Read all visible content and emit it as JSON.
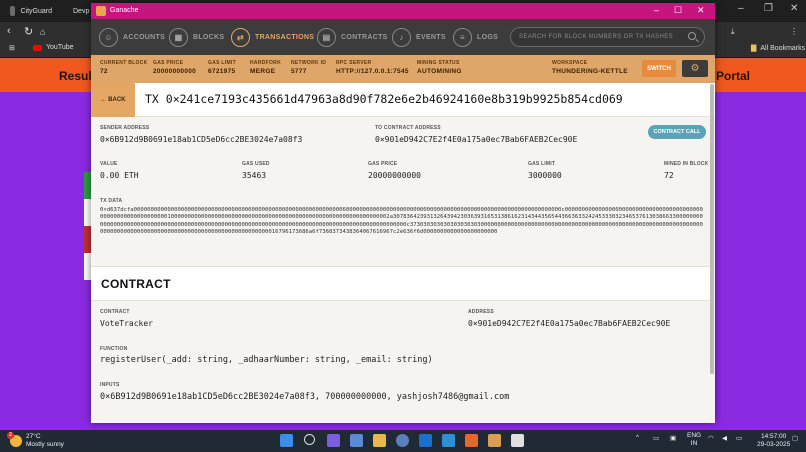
{
  "browser": {
    "tabs": [
      {
        "label": "CityGuard"
      },
      {
        "label": "Devp"
      }
    ],
    "bookmarks": [
      {
        "label": "YouTube"
      },
      {
        "label": "All Bookmarks"
      }
    ],
    "page_text_left": "Result",
    "page_text_right": "Portal"
  },
  "window": {
    "title": "Ganache"
  },
  "nav": {
    "items": [
      {
        "label": "ACCOUNTS",
        "icon": "accounts-icon",
        "active": false
      },
      {
        "label": "BLOCKS",
        "icon": "blocks-icon",
        "active": false
      },
      {
        "label": "TRANSACTIONS",
        "icon": "transactions-icon",
        "active": true
      },
      {
        "label": "CONTRACTS",
        "icon": "contracts-icon",
        "active": false
      },
      {
        "label": "EVENTS",
        "icon": "events-icon",
        "active": false
      },
      {
        "label": "LOGS",
        "icon": "logs-icon",
        "active": false
      }
    ],
    "search_placeholder": "SEARCH FOR BLOCK NUMBERS OR TX HASHES"
  },
  "status": {
    "current_block_label": "CURRENT BLOCK",
    "current_block": "72",
    "gas_price_label": "GAS PRICE",
    "gas_price": "20000000000",
    "gas_limit_label": "GAS LIMIT",
    "gas_limit": "6721975",
    "hardfork_label": "HARDFORK",
    "hardfork": "MERGE",
    "network_id_label": "NETWORK ID",
    "network_id": "5777",
    "rpc_server_label": "RPC SERVER",
    "rpc_server": "HTTP://127.0.0.1:7545",
    "mining_status_label": "MINING STATUS",
    "mining_status": "AUTOMINING",
    "workspace_label": "WORKSPACE",
    "workspace": "THUNDERING-KETTLE",
    "switch_label": "SWITCH"
  },
  "tx": {
    "back_label": "← BACK",
    "hash": "TX 0×241ce7193c435661d47963a8d90f782e6e2b46924160e8b319b9925b854cd069",
    "sender_label": "SENDER ADDRESS",
    "sender": "0×6B912d9B0691e18ab1CD5eD6cc2BE3024e7a08f3",
    "to_label": "TO CONTRACT ADDRESS",
    "to": "0×901eD942C7E2f4E0a175a0ec7Bab6FAEB2Cec90E",
    "call_label": "CONTRACT CALL",
    "value_label": "VALUE",
    "value": "0.00 ETH",
    "gas_used_label": "GAS USED",
    "gas_used": "35463",
    "gas_price_label": "GAS PRICE",
    "gas_price": "20000000000",
    "gas_limit_label": "GAS LIMIT",
    "gas_limit": "3000000",
    "mined_label": "MINED IN BLOCK",
    "mined": "72",
    "data_label": "TX DATA",
    "data": "0×d637dcfa0000000000000000000000000000000000000000000000000000000000000060000000000000000000000000000000000000000000000000000000000000000c0000000000000000000000000000000000000000000000000000000000000100000000000000000000000000000000000000000000000000000000000000002a307836423931326439423036393165313861623143443565443663633242453330323465376130386633000000000000000000000000000000000000000000000000000000000000000000000000000000000000000000000000000c37303030303030303030300000000000000000000000000000000000000000000000000000000000000000000000000000000000000000000000000000000000000000000016796173686a6f7368373438364067616967c2e636f6d0000000000000000000000"
  },
  "contract": {
    "heading": "CONTRACT",
    "contract_label": "CONTRACT",
    "contract_name": "VoteTracker",
    "address_label": "ADDRESS",
    "address": "0×901eD942C7E2f4E0a175a0ec7Bab6FAEB2Cec90E",
    "function_label": "FUNCTION",
    "function": "registerUser(_add: string, _adhaarNumber: string, _email: string)",
    "inputs_label": "INPUTS",
    "inputs": "0×6B912d9B0691e18ab1CD5eD6cc2BE3024e7a08f3, 700000000000, yashjosh7486@gmail.com"
  },
  "taskbar": {
    "temp": "27°C",
    "weather": "Mostly sunny",
    "weather_badge": "2",
    "lang_1": "ENG",
    "lang_2": "IN",
    "time": "14:57:00",
    "date": "29-03-2025"
  },
  "colors": {
    "ganache_title": "#c6157e",
    "accent": "#e4a663",
    "nav_bg": "#3c3c3d",
    "contract_call": "#5aa4b6"
  }
}
